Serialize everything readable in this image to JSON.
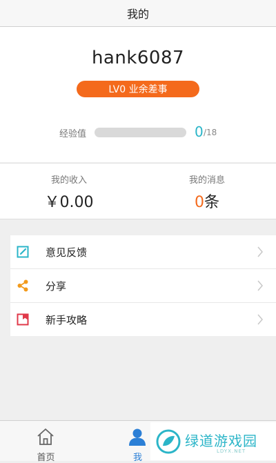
{
  "header": {
    "title": "我的"
  },
  "profile": {
    "username": "hank6087",
    "level_badge": "LV0 业余差事",
    "exp_label": "经验值",
    "exp_value": "0",
    "exp_total": "/18",
    "exp_progress": 0.0
  },
  "stats": {
    "income_label": "我的收入",
    "income_value": "￥0.00",
    "messages_label": "我的消息",
    "messages_count": "0",
    "messages_unit": "条"
  },
  "menu": {
    "items": [
      {
        "label": "意见反馈",
        "icon": "feedback-edit-icon"
      },
      {
        "label": "分享",
        "icon": "share-icon"
      },
      {
        "label": "新手攻略",
        "icon": "bookmark-guide-icon"
      }
    ]
  },
  "tabbar": {
    "tabs": [
      {
        "label": "首页",
        "icon": "home-icon",
        "active": false
      },
      {
        "label": "我",
        "icon": "person-icon",
        "active": true
      }
    ]
  },
  "watermark": {
    "text": "绿道游戏园",
    "sub": "LDYX.NET"
  },
  "colors": {
    "accent_orange": "#f46a1c",
    "accent_teal": "#2bb5c8",
    "active_tab_blue": "#2b7fd6",
    "share_orange": "#f29a1b",
    "guide_red": "#e0394a"
  }
}
